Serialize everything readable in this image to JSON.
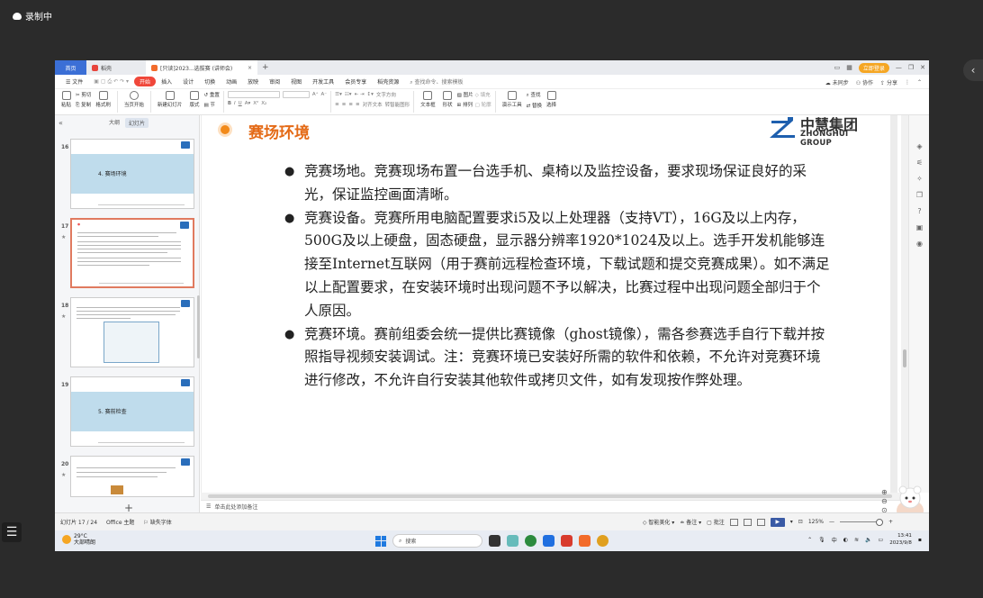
{
  "recorder": {
    "label": "录制中"
  },
  "tabs": {
    "home": "首页",
    "draft": "稻壳",
    "doc": "[只读]2023...选拔赛 (讲师会)",
    "close": "×",
    "add": "+"
  },
  "titlebar": {
    "login": "立即登录"
  },
  "menu": {
    "file": "☰ 文件",
    "items": [
      "开始",
      "插入",
      "设计",
      "切换",
      "动画",
      "放映",
      "审阅",
      "视图",
      "开发工具",
      "会员专享",
      "稻壳资源"
    ],
    "search": "查找命令、搜索模板",
    "right": [
      "未同步",
      "协作",
      "分享"
    ]
  },
  "ribbon": {
    "paste": "粘贴",
    "cut": "剪切",
    "copy": "复制",
    "format_painter": "格式刷",
    "from_start": "当页开始",
    "new_slide": "新建幻灯片",
    "layout": "版式",
    "section": "节",
    "reset": "重置",
    "text_direction": "文字方向",
    "align_text": "对齐文本",
    "smart_graphic": "转智能图形",
    "textbox": "文本框",
    "shape": "形状",
    "picture": "图片",
    "fill": "填充",
    "arrange": "排列",
    "outline": "轮廓",
    "presenter_tools": "演示工具",
    "find": "查找",
    "replace": "替换",
    "select": "选择"
  },
  "left_panel": {
    "tabs": [
      "大纲",
      "幻灯片"
    ],
    "slides": [
      {
        "num": "16",
        "title": "4. 赛场环境"
      },
      {
        "num": "17",
        "title": ""
      },
      {
        "num": "18",
        "title": ""
      },
      {
        "num": "19",
        "title": "5. 赛前检查"
      },
      {
        "num": "20",
        "title": ""
      }
    ]
  },
  "slide": {
    "title": "赛场环境",
    "logo_cn": "中慧集团",
    "logo_en": "ZHONGHUI GROUP",
    "bullets": [
      "竞赛场地。竞赛现场布置一台选手机、桌椅以及监控设备，要求现场保证良好的采光，保证监控画面清晰。",
      "竞赛设备。竞赛所用电脑配置要求i5及以上处理器（支持VT），16G及以上内存，500G及以上硬盘，固态硬盘，显示器分辨率1920*1024及以上。选手开发机能够连接至Internet互联网（用于赛前远程检查环境，下载试题和提交竞赛成果）。如不满足以上配置要求，在安装环境时出现问题不予以解决，比赛过程中出现问题全部归于个人原因。",
      "竞赛环境。赛前组委会统一提供比赛镜像（ghost镜像），需各参赛选手自行下载并按照指导视频安装调试。注：竞赛环境已安装好所需的软件和依赖，不允许对竞赛环境进行修改，不允许自行安装其他软件或拷贝文件，如有发现按作弊处理。"
    ]
  },
  "notes": {
    "placeholder": "单击此处添加备注"
  },
  "status": {
    "slide_count": "幻灯片 17 / 24",
    "theme": "Office 主题",
    "missing_font": "缺失字体",
    "smart_beautify": "智能美化",
    "notes": "备注",
    "comments": "批注",
    "zoom": "125%"
  },
  "taskbar": {
    "temp": "29°C",
    "weather": "大部晴朗",
    "search": "搜索",
    "time": "13:41",
    "date": "2023/9/8",
    "ime": "中"
  },
  "colors": {
    "accent": "#e46a16",
    "wps_red": "#f0473a",
    "home_blue": "#3b6fd6"
  }
}
